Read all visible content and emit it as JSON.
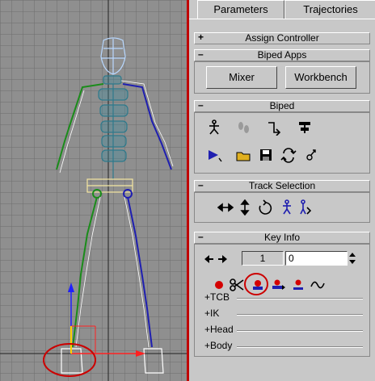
{
  "tabs": {
    "parameters": "Parameters",
    "trajectories": "Trajectories"
  },
  "rollouts": {
    "assign_controller": {
      "sign": "+",
      "title": "Assign Controller"
    },
    "biped_apps": {
      "sign": "–",
      "title": "Biped Apps",
      "mixer": "Mixer",
      "workbench": "Workbench"
    },
    "biped": {
      "sign": "–",
      "title": "Biped"
    },
    "track_selection": {
      "sign": "–",
      "title": "Track Selection"
    },
    "key_info": {
      "sign": "–",
      "title": "Key Info",
      "frame_value": "1",
      "time_value": "0",
      "sub_rollouts": [
        "+TCB",
        "+IK",
        "+Head",
        "+Body"
      ]
    }
  },
  "colors": {
    "accent_red": "#cc0000",
    "left_limb": "#1a8c1a",
    "right_limb": "#1f1fb0",
    "torso": "#2e7a8c"
  }
}
